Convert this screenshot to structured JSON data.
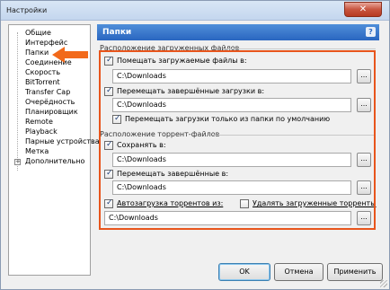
{
  "window": {
    "title": "Настройки",
    "close_glyph": "✕"
  },
  "sidebar": {
    "items": [
      {
        "label": "Общие"
      },
      {
        "label": "Интерфейс"
      },
      {
        "label": "Папки"
      },
      {
        "label": "Соединение"
      },
      {
        "label": "Скорость"
      },
      {
        "label": "BitTorrent"
      },
      {
        "label": "Transfer Cap"
      },
      {
        "label": "Очерёдность"
      },
      {
        "label": "Планировщик"
      },
      {
        "label": "Remote"
      },
      {
        "label": "Playback"
      },
      {
        "label": "Парные устройства"
      },
      {
        "label": "Метка"
      },
      {
        "label": "Дополнительно"
      }
    ],
    "expander_glyph": "+"
  },
  "panel": {
    "title": "Папки",
    "help_glyph": "?"
  },
  "downloaded": {
    "section_title": "Расположение загруженных файлов",
    "put_in": {
      "label": "Помещать загружаемые файлы в:",
      "checked": true,
      "path": "C:\\Downloads"
    },
    "move_completed": {
      "label": "Перемещать завершённые загрузки в:",
      "checked": true,
      "path": "C:\\Downloads"
    },
    "only_default": {
      "label": "Перемещать загрузки только из папки по умолчанию",
      "checked": true
    }
  },
  "torrents": {
    "section_title": "Расположение торрент-файлов",
    "save_to": {
      "label": "Сохранять в:",
      "checked": true,
      "path": "C:\\Downloads"
    },
    "move_completed": {
      "label": "Перемещать завершённые в:",
      "checked": true,
      "path": "C:\\Downloads"
    },
    "autoload": {
      "label": "Автозагрузка торрентов из:",
      "checked": true,
      "path": "C:\\Downloads"
    },
    "delete_loaded": {
      "label": "Удалять загруженные торренты",
      "checked": false
    }
  },
  "browse_label": "...",
  "buttons": {
    "ok": "OK",
    "cancel": "Отмена",
    "apply": "Применить"
  },
  "colors": {
    "accent": "#2a66c0",
    "highlight": "#e8551c",
    "arrow": "#f26a1b"
  }
}
